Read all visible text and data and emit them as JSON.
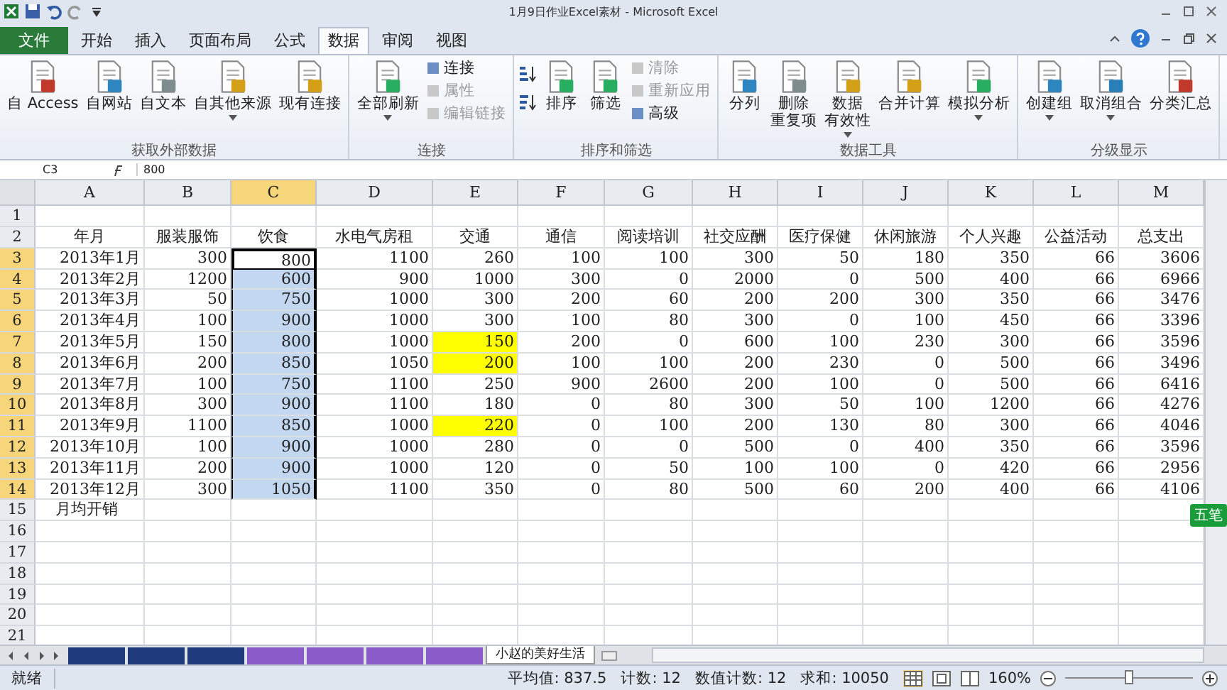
{
  "window": {
    "title": "1月9日作业Excel素材 - Microsoft Excel"
  },
  "tabs": [
    {
      "label": "文件",
      "kind": "file",
      "selected": false
    },
    {
      "label": "开始",
      "kind": "tab",
      "selected": false
    },
    {
      "label": "插入",
      "kind": "tab",
      "selected": false
    },
    {
      "label": "页面布局",
      "kind": "tab",
      "selected": false
    },
    {
      "label": "公式",
      "kind": "tab",
      "selected": false
    },
    {
      "label": "数据",
      "kind": "tab",
      "selected": true
    },
    {
      "label": "审阅",
      "kind": "tab",
      "selected": false
    },
    {
      "label": "视图",
      "kind": "tab",
      "selected": false
    }
  ],
  "ribbon": [
    {
      "title": "获取外部数据",
      "items": [
        {
          "kind": "large",
          "lines": [
            "自 Access"
          ],
          "dropdown": false
        },
        {
          "kind": "large",
          "lines": [
            "自网站"
          ],
          "dropdown": false
        },
        {
          "kind": "large",
          "lines": [
            "自文本"
          ],
          "dropdown": false
        },
        {
          "kind": "large",
          "lines": [
            "自其他来源"
          ],
          "dropdown": true
        },
        {
          "kind": "large",
          "lines": [
            "现有连接"
          ],
          "dropdown": false
        }
      ]
    },
    {
      "title": "连接",
      "items": [
        {
          "kind": "large",
          "lines": [
            "全部刷新"
          ],
          "dropdown": true
        },
        {
          "kind": "small",
          "label": "连接",
          "disabled": false
        },
        {
          "kind": "small",
          "label": "属性",
          "disabled": true
        },
        {
          "kind": "small",
          "label": "编辑链接",
          "disabled": true
        }
      ]
    },
    {
      "title": "排序和筛选",
      "items": [
        {
          "kind": "sort"
        },
        {
          "kind": "large",
          "lines": [
            "排序"
          ],
          "dropdown": false
        },
        {
          "kind": "large",
          "lines": [
            "筛选"
          ],
          "dropdown": false
        },
        {
          "kind": "small",
          "label": "清除",
          "disabled": true
        },
        {
          "kind": "small",
          "label": "重新应用",
          "disabled": true
        },
        {
          "kind": "small",
          "label": "高级",
          "disabled": false
        }
      ]
    },
    {
      "title": "数据工具",
      "items": [
        {
          "kind": "large",
          "lines": [
            "分列"
          ],
          "dropdown": false
        },
        {
          "kind": "large",
          "lines": [
            "删除",
            "重复项"
          ],
          "dropdown": false
        },
        {
          "kind": "large",
          "lines": [
            "数据",
            "有效性"
          ],
          "dropdown": true
        },
        {
          "kind": "large",
          "lines": [
            "合并计算"
          ],
          "dropdown": false
        },
        {
          "kind": "large",
          "lines": [
            "模拟分析"
          ],
          "dropdown": true
        }
      ]
    },
    {
      "title": "分级显示",
      "items": [
        {
          "kind": "large",
          "lines": [
            "创建组"
          ],
          "dropdown": true
        },
        {
          "kind": "large",
          "lines": [
            "取消组合"
          ],
          "dropdown": true
        },
        {
          "kind": "large",
          "lines": [
            "分类汇总"
          ],
          "dropdown": false
        }
      ]
    }
  ],
  "formula_bar": {
    "name_box": "C3",
    "value": "800"
  },
  "columns": [
    {
      "label": "A",
      "selected": false
    },
    {
      "label": "B",
      "selected": false
    },
    {
      "label": "C",
      "selected": true
    },
    {
      "label": "D",
      "selected": false
    },
    {
      "label": "E",
      "selected": false
    },
    {
      "label": "F",
      "selected": false
    },
    {
      "label": "G",
      "selected": false
    },
    {
      "label": "H",
      "selected": false
    },
    {
      "label": "I",
      "selected": false
    },
    {
      "label": "J",
      "selected": false
    },
    {
      "label": "K",
      "selected": false
    },
    {
      "label": "L",
      "selected": false
    },
    {
      "label": "M",
      "selected": false
    }
  ],
  "rows": [
    {
      "number": "1",
      "kind": "empty",
      "cells": []
    },
    {
      "number": "2",
      "kind": "header",
      "cells": [
        "年月",
        "服装服饰",
        "饮食",
        "水电气房租",
        "交通",
        "通信",
        "阅读培训",
        "社交应酬",
        "医疗保健",
        "休闲旅游",
        "个人兴趣",
        "公益活动",
        "总支出"
      ]
    },
    {
      "number": "3",
      "kind": "data",
      "selected": true,
      "active": true,
      "cell_highlight": [
        false,
        false,
        false,
        false,
        false,
        false,
        false,
        false,
        false,
        false,
        false,
        false,
        false
      ],
      "cells": [
        "2013年1月",
        "300",
        "800",
        "1100",
        "260",
        "100",
        "100",
        "300",
        "50",
        "180",
        "350",
        "66",
        "3606"
      ]
    },
    {
      "number": "4",
      "kind": "data",
      "selected": true,
      "active": false,
      "cell_highlight": [
        false,
        false,
        false,
        false,
        false,
        false,
        false,
        false,
        false,
        false,
        false,
        false,
        false
      ],
      "cells": [
        "2013年2月",
        "1200",
        "600",
        "900",
        "1000",
        "300",
        "0",
        "2000",
        "0",
        "500",
        "400",
        "66",
        "6966"
      ]
    },
    {
      "number": "5",
      "kind": "data",
      "selected": true,
      "active": false,
      "cell_highlight": [
        false,
        false,
        false,
        false,
        false,
        false,
        false,
        false,
        false,
        false,
        false,
        false,
        false
      ],
      "cells": [
        "2013年3月",
        "50",
        "750",
        "1000",
        "300",
        "200",
        "60",
        "200",
        "200",
        "300",
        "350",
        "66",
        "3476"
      ]
    },
    {
      "number": "6",
      "kind": "data",
      "selected": true,
      "active": false,
      "cell_highlight": [
        false,
        false,
        false,
        false,
        false,
        false,
        false,
        false,
        false,
        false,
        false,
        false,
        false
      ],
      "cells": [
        "2013年4月",
        "100",
        "900",
        "1000",
        "300",
        "100",
        "80",
        "300",
        "0",
        "100",
        "450",
        "66",
        "3396"
      ]
    },
    {
      "number": "7",
      "kind": "data",
      "selected": true,
      "active": false,
      "cell_highlight": [
        false,
        false,
        false,
        false,
        true,
        false,
        false,
        false,
        false,
        false,
        false,
        false,
        false
      ],
      "cells": [
        "2013年5月",
        "150",
        "800",
        "1000",
        "150",
        "200",
        "0",
        "600",
        "100",
        "230",
        "300",
        "66",
        "3596"
      ]
    },
    {
      "number": "8",
      "kind": "data",
      "selected": true,
      "active": false,
      "cell_highlight": [
        false,
        false,
        false,
        false,
        true,
        false,
        false,
        false,
        false,
        false,
        false,
        false,
        false
      ],
      "cells": [
        "2013年6月",
        "200",
        "850",
        "1050",
        "200",
        "100",
        "100",
        "200",
        "230",
        "0",
        "500",
        "66",
        "3496"
      ]
    },
    {
      "number": "9",
      "kind": "data",
      "selected": true,
      "active": false,
      "cell_highlight": [
        false,
        false,
        false,
        false,
        false,
        false,
        false,
        false,
        false,
        false,
        false,
        false,
        false
      ],
      "cells": [
        "2013年7月",
        "100",
        "750",
        "1100",
        "250",
        "900",
        "2600",
        "200",
        "100",
        "0",
        "500",
        "66",
        "6416"
      ]
    },
    {
      "number": "10",
      "kind": "data",
      "selected": true,
      "active": false,
      "cell_highlight": [
        false,
        false,
        false,
        false,
        false,
        false,
        false,
        false,
        false,
        false,
        false,
        false,
        false
      ],
      "cells": [
        "2013年8月",
        "300",
        "900",
        "1100",
        "180",
        "0",
        "80",
        "300",
        "50",
        "100",
        "1200",
        "66",
        "4276"
      ]
    },
    {
      "number": "11",
      "kind": "data",
      "selected": true,
      "active": false,
      "cell_highlight": [
        false,
        false,
        false,
        false,
        true,
        false,
        false,
        false,
        false,
        false,
        false,
        false,
        false
      ],
      "cells": [
        "2013年9月",
        "1100",
        "850",
        "1000",
        "220",
        "0",
        "100",
        "200",
        "130",
        "80",
        "300",
        "66",
        "4046"
      ]
    },
    {
      "number": "12",
      "kind": "data",
      "selected": true,
      "active": false,
      "cell_highlight": [
        false,
        false,
        false,
        false,
        false,
        false,
        false,
        false,
        false,
        false,
        false,
        false,
        false
      ],
      "cells": [
        "2013年10月",
        "100",
        "900",
        "1000",
        "280",
        "0",
        "0",
        "500",
        "0",
        "400",
        "350",
        "66",
        "3596"
      ]
    },
    {
      "number": "13",
      "kind": "data",
      "selected": true,
      "active": false,
      "cell_highlight": [
        false,
        false,
        false,
        false,
        false,
        false,
        false,
        false,
        false,
        false,
        false,
        false,
        false
      ],
      "cells": [
        "2013年11月",
        "200",
        "900",
        "1000",
        "120",
        "0",
        "50",
        "100",
        "100",
        "0",
        "420",
        "66",
        "2956"
      ]
    },
    {
      "number": "14",
      "kind": "data",
      "selected": true,
      "active": false,
      "cell_highlight": [
        false,
        false,
        false,
        false,
        false,
        false,
        false,
        false,
        false,
        false,
        false,
        false,
        false
      ],
      "cells": [
        "2013年12月",
        "300",
        "1050",
        "1100",
        "350",
        "0",
        "80",
        "500",
        "60",
        "200",
        "400",
        "66",
        "4106"
      ]
    },
    {
      "number": "15",
      "kind": "label",
      "cells": [
        "月均开销"
      ]
    },
    {
      "number": "16",
      "kind": "empty",
      "cells": []
    },
    {
      "number": "17",
      "kind": "empty",
      "cells": []
    },
    {
      "number": "18",
      "kind": "empty",
      "cells": []
    },
    {
      "number": "19",
      "kind": "empty",
      "cells": []
    },
    {
      "number": "20",
      "kind": "empty",
      "cells": []
    },
    {
      "number": "21",
      "kind": "empty",
      "cells": []
    }
  ],
  "sheet_tabs": [
    {
      "color": "#1f3a7a",
      "selected": false
    },
    {
      "color": "#1f3a7a",
      "selected": false
    },
    {
      "color": "#1f3a7a",
      "selected": false
    },
    {
      "color": "#8a5bc9",
      "selected": false
    },
    {
      "color": "#8a5bc9",
      "selected": false
    },
    {
      "color": "#8a5bc9",
      "selected": false
    },
    {
      "color": "#8a5bc9",
      "selected": false
    },
    {
      "label": "小赵的美好生活",
      "selected": true
    }
  ],
  "ime_badge": "五笔",
  "status_bar": {
    "state": "就绪",
    "stats": [
      "平均值: 837.5",
      "计数: 12",
      "数值计数: 12",
      "求和: 10050"
    ],
    "zoom": "160%",
    "zoom_slider": {
      "level": 0.5
    }
  }
}
